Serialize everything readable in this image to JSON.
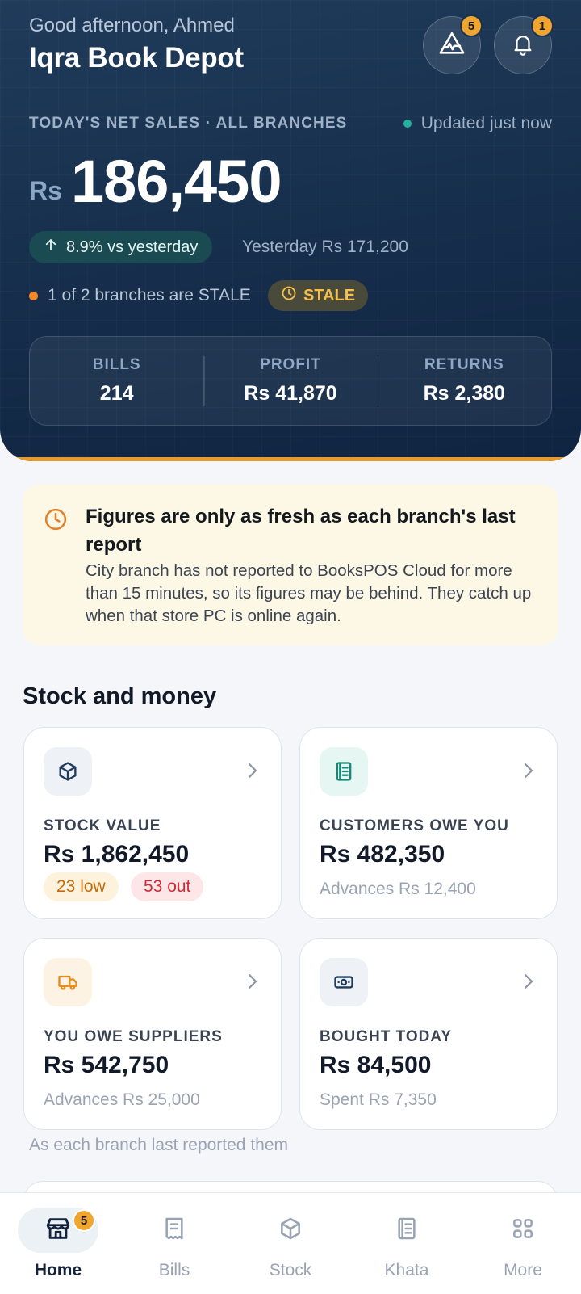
{
  "hero": {
    "greeting": "Good afternoon, Ahmed",
    "shop_name": "Iqra Book Depot",
    "alerts_count": "5",
    "notifications_count": "1",
    "net_sales_label": "TODAY'S NET SALES · ALL BRANCHES",
    "updated_text": "Updated just now",
    "currency": "Rs",
    "amount": "186,450",
    "change_text": "8.9% vs yesterday",
    "yesterday_text": "Yesterday Rs 171,200",
    "stale_text": "1 of 2 branches are STALE",
    "stale_badge": "STALE",
    "stats": [
      {
        "label": "BILLS",
        "value": "214"
      },
      {
        "label": "PROFIT",
        "value": "Rs 41,870"
      },
      {
        "label": "RETURNS",
        "value": "Rs 2,380"
      }
    ]
  },
  "notice": {
    "title": "Figures are only as fresh as each branch's last report",
    "body": "City branch has not reported to BooksPOS Cloud for more than 15 minutes, so its figures may be behind. They catch up when that store PC is online again."
  },
  "section": {
    "title": "Stock and money",
    "cards": [
      {
        "label": "STOCK VALUE",
        "value": "Rs 1,862,450",
        "low": "23 low",
        "out": "53 out",
        "icon": "box-icon"
      },
      {
        "label": "CUSTOMERS OWE YOU",
        "value": "Rs 482,350",
        "sub": "Advances Rs 12,400",
        "icon": "ledger-icon"
      },
      {
        "label": "YOU OWE SUPPLIERS",
        "value": "Rs 542,750",
        "sub": "Advances Rs 25,000",
        "icon": "truck-icon"
      },
      {
        "label": "BOUGHT TODAY",
        "value": "Rs 84,500",
        "sub": "Spent Rs 7,350",
        "icon": "cash-icon"
      }
    ],
    "footnote": "As each branch last reported them"
  },
  "nav": {
    "items": [
      {
        "label": "Home",
        "badge": "5"
      },
      {
        "label": "Bills"
      },
      {
        "label": "Stock"
      },
      {
        "label": "Khata"
      },
      {
        "label": "More"
      }
    ]
  },
  "colors": {
    "hero_bg": "#17304d",
    "accent": "#f0a52f",
    "stale": "#f5c04d",
    "positive": "#22b39a",
    "danger": "#d42a36"
  }
}
